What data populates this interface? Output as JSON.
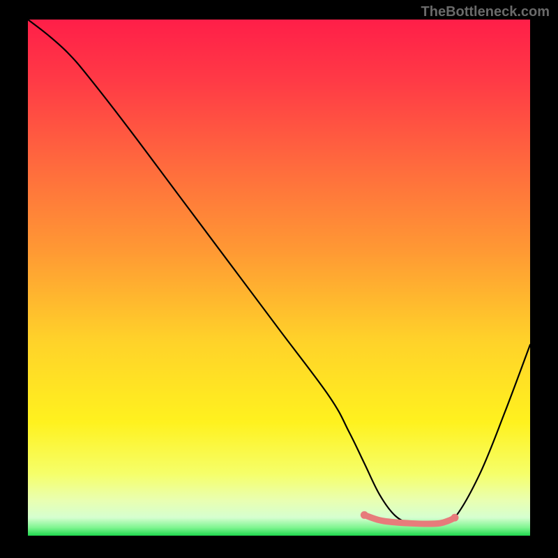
{
  "watermark": "TheBottleneck.com",
  "gradient": {
    "stops": [
      {
        "offset": 0.0,
        "color": "#ff1f49"
      },
      {
        "offset": 0.12,
        "color": "#ff3b46"
      },
      {
        "offset": 0.28,
        "color": "#ff6a3e"
      },
      {
        "offset": 0.45,
        "color": "#ff9a34"
      },
      {
        "offset": 0.62,
        "color": "#ffd22a"
      },
      {
        "offset": 0.78,
        "color": "#fff21f"
      },
      {
        "offset": 0.88,
        "color": "#f6ff6a"
      },
      {
        "offset": 0.93,
        "color": "#eaffb0"
      },
      {
        "offset": 0.965,
        "color": "#d6ffd0"
      },
      {
        "offset": 0.985,
        "color": "#7cf58f"
      },
      {
        "offset": 1.0,
        "color": "#1fd84e"
      }
    ]
  },
  "chart_data": {
    "type": "line",
    "title": "",
    "xlabel": "",
    "ylabel": "",
    "xlim": [
      0,
      100
    ],
    "ylim": [
      0,
      100
    ],
    "series": [
      {
        "name": "curve",
        "x": [
          0,
          4,
          8,
          12,
          20,
          30,
          40,
          50,
          60,
          64,
          67,
          70,
          73,
          76,
          79,
          82,
          85,
          90,
          95,
          100
        ],
        "y": [
          100,
          97,
          93.5,
          89,
          79,
          66,
          53,
          40,
          27,
          20,
          14,
          8,
          4,
          2.4,
          2.2,
          2.3,
          3.5,
          12,
          24,
          37
        ]
      }
    ],
    "highlight": {
      "name": "flat-bottom",
      "color": "#e77b7b",
      "x": [
        67,
        70,
        73,
        76,
        79,
        82,
        84,
        85
      ],
      "y": [
        4.0,
        3.0,
        2.6,
        2.4,
        2.3,
        2.4,
        3.0,
        3.5
      ]
    }
  }
}
